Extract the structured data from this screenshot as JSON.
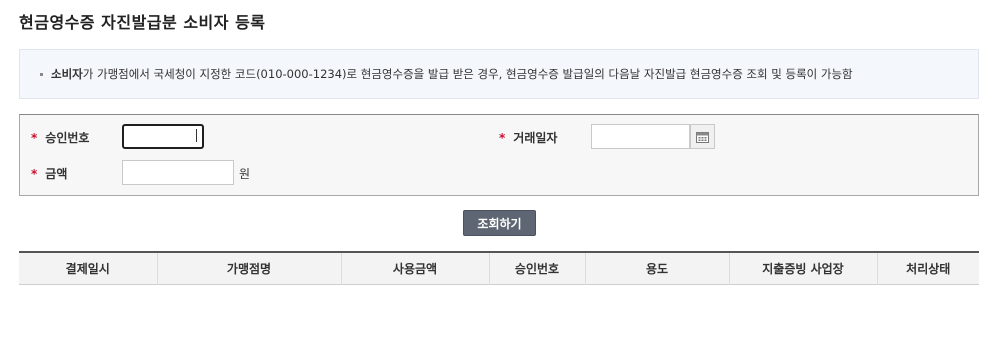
{
  "page": {
    "title": "현금영수증 자진발급분 소비자 등록"
  },
  "notice": {
    "strong_text": "소비자",
    "text": "가 가맹점에서 국세청이 지정한 코드(010-000-1234)로 현금영수증을 발급 받은 경우, 현금영수증 발급일의 다음날 자진발급 현금영수증 조회 및 등록이 가능함"
  },
  "form": {
    "required_mark": "*",
    "approval_label": "승인번호",
    "approval_value": "",
    "date_label": "거래일자",
    "date_value": "",
    "amount_label": "금액",
    "amount_value": "",
    "amount_unit": "원",
    "search_button": "조회하기"
  },
  "table": {
    "headers": [
      "결제일시",
      "가맹점명",
      "사용금액",
      "승인번호",
      "용도",
      "지출증빙 사업장",
      "처리상태"
    ]
  },
  "icons": {
    "calendar": "calendar-icon"
  },
  "colors": {
    "required": "#c8102e",
    "button_bg": "#5e6673"
  }
}
